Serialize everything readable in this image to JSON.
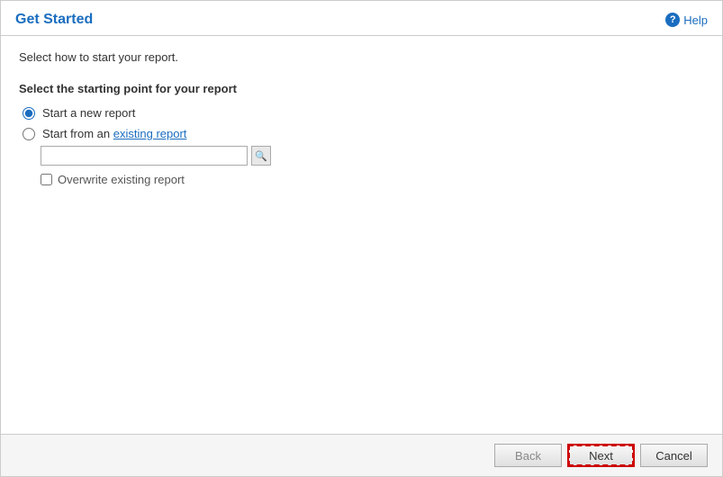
{
  "header": {
    "title": "Get Started",
    "help_label": "Help"
  },
  "content": {
    "subtitle": "Select how to start your report.",
    "section_label": "Select the starting point for your report",
    "radio_options": [
      {
        "id": "new-report",
        "label": "Start a new report",
        "checked": true
      },
      {
        "id": "existing-report",
        "label_prefix": "Start from an ",
        "label_link": "existing report",
        "label_suffix": "",
        "checked": false
      }
    ],
    "existing_input_placeholder": "",
    "overwrite_label": "Overwrite existing report"
  },
  "footer": {
    "back_label": "Back",
    "next_label": "Next",
    "cancel_label": "Cancel"
  }
}
